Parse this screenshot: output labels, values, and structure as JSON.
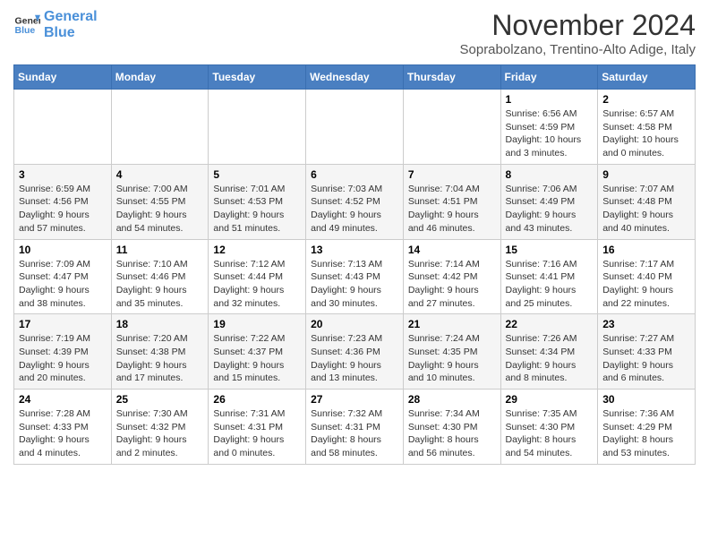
{
  "header": {
    "logo_line1": "General",
    "logo_line2": "Blue",
    "month": "November 2024",
    "location": "Soprabolzano, Trentino-Alto Adige, Italy"
  },
  "days_of_week": [
    "Sunday",
    "Monday",
    "Tuesday",
    "Wednesday",
    "Thursday",
    "Friday",
    "Saturday"
  ],
  "weeks": [
    [
      {
        "day": "",
        "info": ""
      },
      {
        "day": "",
        "info": ""
      },
      {
        "day": "",
        "info": ""
      },
      {
        "day": "",
        "info": ""
      },
      {
        "day": "",
        "info": ""
      },
      {
        "day": "1",
        "info": "Sunrise: 6:56 AM\nSunset: 4:59 PM\nDaylight: 10 hours and 3 minutes."
      },
      {
        "day": "2",
        "info": "Sunrise: 6:57 AM\nSunset: 4:58 PM\nDaylight: 10 hours and 0 minutes."
      }
    ],
    [
      {
        "day": "3",
        "info": "Sunrise: 6:59 AM\nSunset: 4:56 PM\nDaylight: 9 hours and 57 minutes."
      },
      {
        "day": "4",
        "info": "Sunrise: 7:00 AM\nSunset: 4:55 PM\nDaylight: 9 hours and 54 minutes."
      },
      {
        "day": "5",
        "info": "Sunrise: 7:01 AM\nSunset: 4:53 PM\nDaylight: 9 hours and 51 minutes."
      },
      {
        "day": "6",
        "info": "Sunrise: 7:03 AM\nSunset: 4:52 PM\nDaylight: 9 hours and 49 minutes."
      },
      {
        "day": "7",
        "info": "Sunrise: 7:04 AM\nSunset: 4:51 PM\nDaylight: 9 hours and 46 minutes."
      },
      {
        "day": "8",
        "info": "Sunrise: 7:06 AM\nSunset: 4:49 PM\nDaylight: 9 hours and 43 minutes."
      },
      {
        "day": "9",
        "info": "Sunrise: 7:07 AM\nSunset: 4:48 PM\nDaylight: 9 hours and 40 minutes."
      }
    ],
    [
      {
        "day": "10",
        "info": "Sunrise: 7:09 AM\nSunset: 4:47 PM\nDaylight: 9 hours and 38 minutes."
      },
      {
        "day": "11",
        "info": "Sunrise: 7:10 AM\nSunset: 4:46 PM\nDaylight: 9 hours and 35 minutes."
      },
      {
        "day": "12",
        "info": "Sunrise: 7:12 AM\nSunset: 4:44 PM\nDaylight: 9 hours and 32 minutes."
      },
      {
        "day": "13",
        "info": "Sunrise: 7:13 AM\nSunset: 4:43 PM\nDaylight: 9 hours and 30 minutes."
      },
      {
        "day": "14",
        "info": "Sunrise: 7:14 AM\nSunset: 4:42 PM\nDaylight: 9 hours and 27 minutes."
      },
      {
        "day": "15",
        "info": "Sunrise: 7:16 AM\nSunset: 4:41 PM\nDaylight: 9 hours and 25 minutes."
      },
      {
        "day": "16",
        "info": "Sunrise: 7:17 AM\nSunset: 4:40 PM\nDaylight: 9 hours and 22 minutes."
      }
    ],
    [
      {
        "day": "17",
        "info": "Sunrise: 7:19 AM\nSunset: 4:39 PM\nDaylight: 9 hours and 20 minutes."
      },
      {
        "day": "18",
        "info": "Sunrise: 7:20 AM\nSunset: 4:38 PM\nDaylight: 9 hours and 17 minutes."
      },
      {
        "day": "19",
        "info": "Sunrise: 7:22 AM\nSunset: 4:37 PM\nDaylight: 9 hours and 15 minutes."
      },
      {
        "day": "20",
        "info": "Sunrise: 7:23 AM\nSunset: 4:36 PM\nDaylight: 9 hours and 13 minutes."
      },
      {
        "day": "21",
        "info": "Sunrise: 7:24 AM\nSunset: 4:35 PM\nDaylight: 9 hours and 10 minutes."
      },
      {
        "day": "22",
        "info": "Sunrise: 7:26 AM\nSunset: 4:34 PM\nDaylight: 9 hours and 8 minutes."
      },
      {
        "day": "23",
        "info": "Sunrise: 7:27 AM\nSunset: 4:33 PM\nDaylight: 9 hours and 6 minutes."
      }
    ],
    [
      {
        "day": "24",
        "info": "Sunrise: 7:28 AM\nSunset: 4:33 PM\nDaylight: 9 hours and 4 minutes."
      },
      {
        "day": "25",
        "info": "Sunrise: 7:30 AM\nSunset: 4:32 PM\nDaylight: 9 hours and 2 minutes."
      },
      {
        "day": "26",
        "info": "Sunrise: 7:31 AM\nSunset: 4:31 PM\nDaylight: 9 hours and 0 minutes."
      },
      {
        "day": "27",
        "info": "Sunrise: 7:32 AM\nSunset: 4:31 PM\nDaylight: 8 hours and 58 minutes."
      },
      {
        "day": "28",
        "info": "Sunrise: 7:34 AM\nSunset: 4:30 PM\nDaylight: 8 hours and 56 minutes."
      },
      {
        "day": "29",
        "info": "Sunrise: 7:35 AM\nSunset: 4:30 PM\nDaylight: 8 hours and 54 minutes."
      },
      {
        "day": "30",
        "info": "Sunrise: 7:36 AM\nSunset: 4:29 PM\nDaylight: 8 hours and 53 minutes."
      }
    ]
  ]
}
